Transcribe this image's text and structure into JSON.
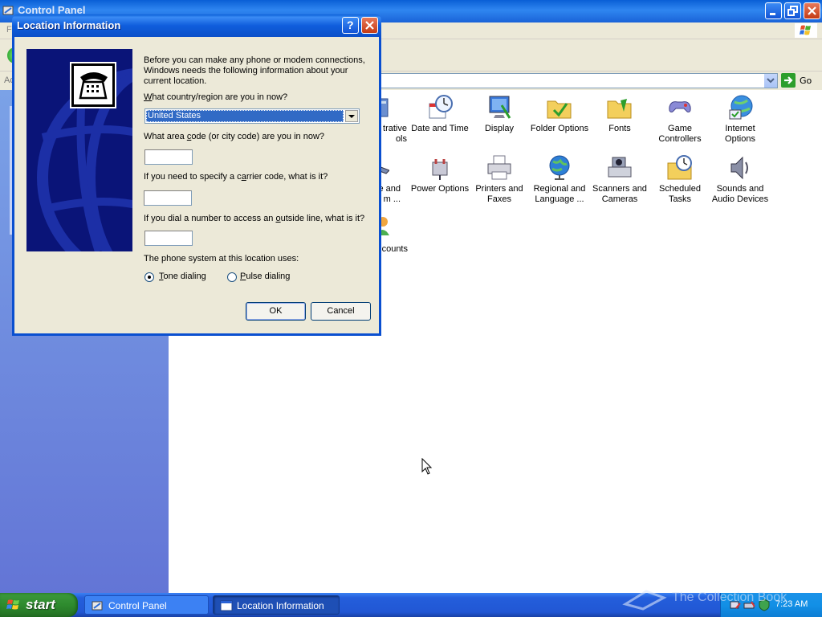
{
  "control_panel": {
    "title": "Control Panel",
    "menu_stub": "F",
    "address_stub": "Ac",
    "go_label": "Go",
    "items": [
      {
        "label": "Administrative Tools",
        "visible_label": "...trative\nols",
        "icon": "admin-tools-icon"
      },
      {
        "label": "Date and Time",
        "icon": "date-time-icon"
      },
      {
        "label": "Display",
        "icon": "display-icon"
      },
      {
        "label": "Folder Options",
        "icon": "folder-options-icon"
      },
      {
        "label": "Fonts",
        "icon": "fonts-folder-icon"
      },
      {
        "label": "Game Controllers",
        "icon": "game-controller-icon"
      },
      {
        "label": "Internet Options",
        "icon": "internet-options-icon"
      },
      {
        "label": "e and\nm ...",
        "icon": "phone-modem-icon"
      },
      {
        "label": "Power Options",
        "icon": "power-options-icon"
      },
      {
        "label": "Printers and Faxes",
        "icon": "printer-icon"
      },
      {
        "label": "Regional and Language ...",
        "icon": "globe-icon"
      },
      {
        "label": "Scanners and Cameras",
        "icon": "scanner-icon"
      },
      {
        "label": "Scheduled Tasks",
        "icon": "scheduled-tasks-icon"
      },
      {
        "label": "Sounds and Audio Devices",
        "icon": "speaker-icon"
      },
      {
        "label": "counts",
        "icon": "user-accounts-icon"
      }
    ]
  },
  "dialog": {
    "title": "Location Information",
    "help_glyph": "?",
    "intro": "Before you can make any phone or modem connections, Windows needs the following information about your current location.",
    "country_question": "What country/region are you in now?",
    "country_value": "United States",
    "area_code_question": "What area code (or city code) are you in now?",
    "area_code_value": "",
    "carrier_question": "If you need to specify a carrier code, what is it?",
    "carrier_value": "",
    "outside_line_question": "If you dial a number to access an outside line, what is it?",
    "outside_line_value": "",
    "phone_system_label": "The phone system at this location uses:",
    "tone_label": "Tone dialing",
    "pulse_label": "Pulse dialing",
    "dialing_mode": "tone",
    "ok_label": "OK",
    "cancel_label": "Cancel"
  },
  "taskbar": {
    "start_label": "start",
    "tasks": [
      {
        "label": "Control Panel",
        "active": false
      },
      {
        "label": "Location Information",
        "active": true
      }
    ],
    "clock": "7:23 AM",
    "watermark": "The Collection Book"
  },
  "colors": {
    "title_blue": "#0a5fd6",
    "dialog_bg": "#ece9d8",
    "left_panel": "#6f8ee0",
    "start_green": "#2e8b2e",
    "selection": "#316ac5"
  }
}
